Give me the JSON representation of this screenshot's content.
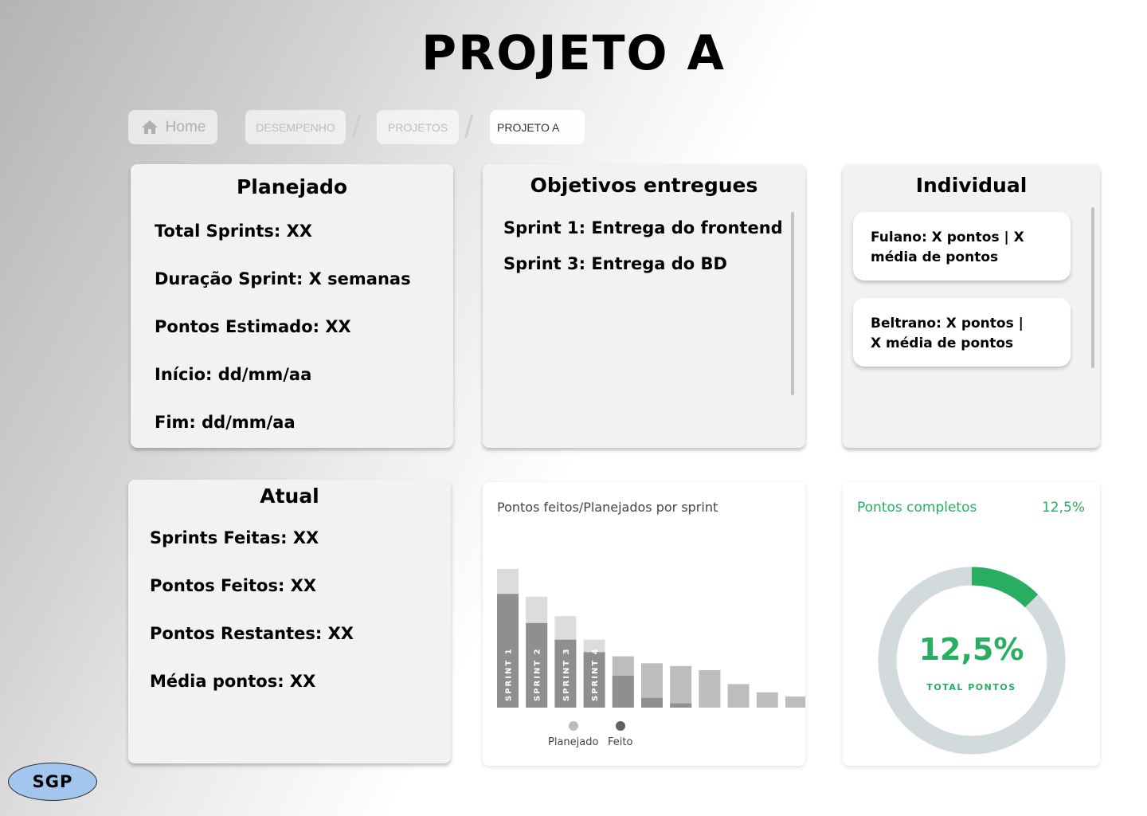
{
  "page": {
    "title": "PROJETO A"
  },
  "breadcrumb": {
    "home": "Home",
    "items": [
      "DESEMPENHO",
      "PROJETOS",
      "PROJETO A"
    ],
    "separator": "/"
  },
  "planejado": {
    "title": "Planejado",
    "lines": [
      "Total Sprints: XX",
      "Duração Sprint: X semanas",
      "Pontos Estimado: XX",
      "Início: dd/mm/aa",
      "Fim: dd/mm/aa"
    ]
  },
  "objetivos": {
    "title": "Objetivos entregues",
    "lines": [
      "Sprint 1: Entrega do frontend",
      "Sprint 3: Entrega do BD"
    ]
  },
  "individual": {
    "title": "Individual",
    "people": [
      {
        "line1": "Fulano: X pontos | X",
        "line2": "média de pontos"
      },
      {
        "line1": "Beltrano: X pontos |",
        "line2": "X média de pontos"
      }
    ]
  },
  "atual": {
    "title": "Atual",
    "lines": [
      "Sprints Feitas: XX",
      "Pontos Feitos: XX",
      "Pontos Restantes: XX",
      "Média pontos: XX"
    ]
  },
  "chart_data": {
    "type": "bar",
    "title": "Pontos feitos/Planejados por sprint",
    "categories": [
      "SPRINT 1",
      "SPRINT 2",
      "SPRINT 3",
      "SPRINT 4",
      "",
      "",
      "",
      "",
      "",
      "",
      ""
    ],
    "series": [
      {
        "name": "Planejado",
        "values": [
          100,
          80,
          66,
          49,
          37,
          32,
          30,
          27,
          17,
          11,
          8
        ]
      },
      {
        "name": "Feito",
        "values": [
          82,
          61,
          49,
          40,
          23,
          7,
          3,
          0,
          0,
          0,
          0
        ]
      }
    ],
    "legend": "bottom",
    "colors": {
      "planejado": "#bdbdbd",
      "feito": "#8f8f8f",
      "planejado_top": "#dcdcdc"
    }
  },
  "donut": {
    "label": "Pontos completos",
    "value_text": "12,5%",
    "center_text": "12,5%",
    "sub_text": "TOTAL PONTOS",
    "fraction": 0.125,
    "color": "#27ae60",
    "track_color": "#d3dade"
  },
  "badge": {
    "label": "SGP"
  }
}
